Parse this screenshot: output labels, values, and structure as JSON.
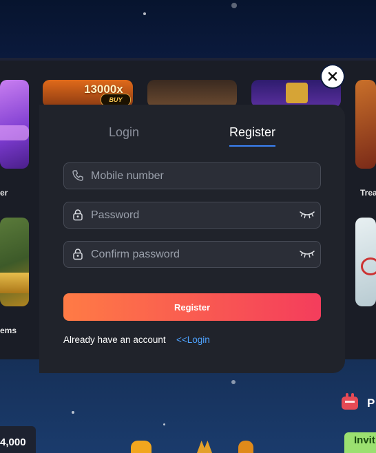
{
  "modal": {
    "tabs": {
      "login": "Login",
      "register": "Register",
      "active": "Register"
    },
    "fields": {
      "mobile": {
        "placeholder": "Mobile number",
        "icon": "phone-icon"
      },
      "password": {
        "placeholder": "Password",
        "icon": "lock-icon",
        "toggle_icon": "eye-closed-icon"
      },
      "confirm": {
        "placeholder": "Confirm password",
        "icon": "lock-icon",
        "toggle_icon": "eye-closed-icon"
      }
    },
    "submit_label": "Register",
    "footer": {
      "text": "Already have an account",
      "link": "<<Login"
    },
    "close_icon": "close-icon"
  },
  "games": {
    "row1_mult": "13000x",
    "row1_buy": "BUY",
    "captions": {
      "left1": "er",
      "right1": "Trea",
      "left2": "ems"
    }
  },
  "bottom": {
    "amount": "4,000",
    "promo_partial": "P",
    "invite_partial": "Invit"
  },
  "colors": {
    "accent": "#3b82f6",
    "submit_start": "#ff7b45",
    "submit_end": "#f43d5c",
    "link": "#4ea3ff"
  }
}
